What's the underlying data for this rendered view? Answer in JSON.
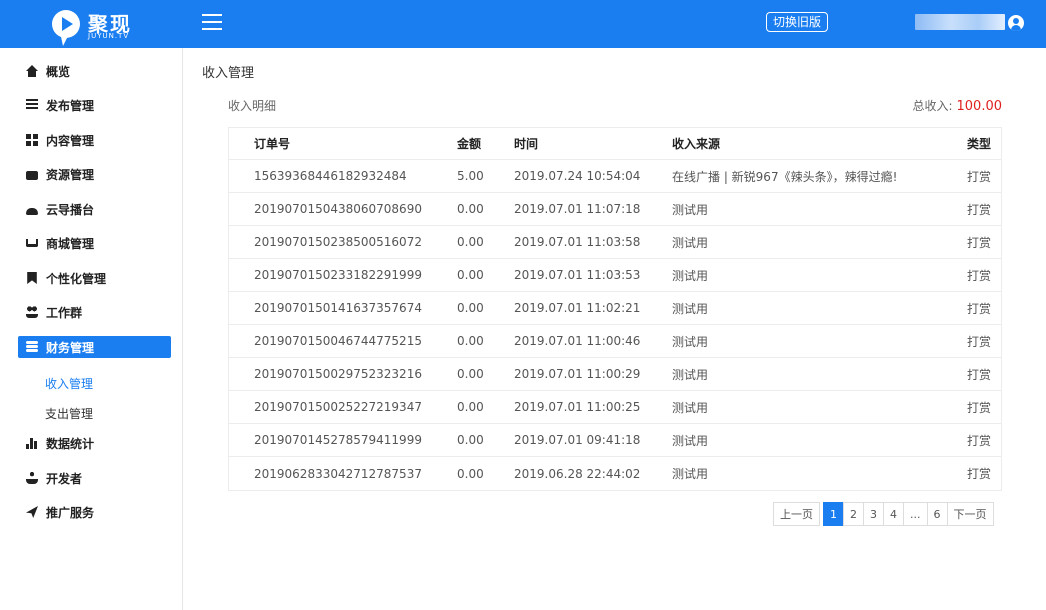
{
  "header": {
    "brand": "聚现",
    "brand_sub": "JUYUN.TV",
    "old_version_label": "切换旧版",
    "colors": {
      "primary": "#1a7ef0"
    }
  },
  "sidebar": {
    "items": [
      {
        "label": "概览",
        "icon": "home-icon"
      },
      {
        "label": "发布管理",
        "icon": "list-icon"
      },
      {
        "label": "内容管理",
        "icon": "grid-icon"
      },
      {
        "label": "资源管理",
        "icon": "hdd-icon"
      },
      {
        "label": "云导播台",
        "icon": "cloud-icon"
      },
      {
        "label": "商城管理",
        "icon": "cart-icon"
      },
      {
        "label": "个性化管理",
        "icon": "bookmark-icon"
      },
      {
        "label": "工作群",
        "icon": "users-icon"
      },
      {
        "label": "财务管理",
        "icon": "database-icon"
      },
      {
        "label": "数据统计",
        "icon": "bar-chart-icon"
      },
      {
        "label": "开发者",
        "icon": "user-icon"
      },
      {
        "label": "推广服务",
        "icon": "send-icon"
      }
    ],
    "sub_items": [
      {
        "label": "收入管理"
      },
      {
        "label": "支出管理"
      }
    ]
  },
  "main": {
    "page_title": "收入管理",
    "section_title": "收入明细",
    "total_label": "总收入:",
    "total_amount": "100.00",
    "table": {
      "headers": [
        "订单号",
        "金额",
        "时间",
        "收入来源",
        "类型"
      ],
      "rows": [
        [
          "15639368446182932484",
          "5.00",
          "2019.07.24 10:54:04",
          "在线广播 | 新锐967《辣头条》，辣得过瘾!",
          "打赏"
        ],
        [
          "201907015043806070869​0",
          "0.00",
          "2019.07.01 11:07:18",
          "测试用",
          "打赏"
        ],
        [
          "20190701502385005​16072",
          "0.00",
          "2019.07.01 11:03:58",
          "测试用",
          "打赏"
        ],
        [
          "20190701502331822​91999",
          "0.00",
          "2019.07.01 11:03:53",
          "测试用",
          "打赏"
        ],
        [
          "20190701501416373​57674",
          "0.00",
          "2019.07.01 11:02:21",
          "测试用",
          "打赏"
        ],
        [
          "20190701500467447​75215",
          "0.00",
          "2019.07.01 11:00:46",
          "测试用",
          "打赏"
        ],
        [
          "20190701500297523​23216",
          "0.00",
          "2019.07.01 11:00:29",
          "测试用",
          "打赏"
        ],
        [
          "20190701500252272​19347",
          "0.00",
          "2019.07.01 11:00:25",
          "测试用",
          "打赏"
        ],
        [
          "20190701452785794​11999",
          "0.00",
          "2019.07.01 09:41:18",
          "测试用",
          "打赏"
        ],
        [
          "20190628330427127​87537",
          "0.00",
          "2019.06.28 22:44:02",
          "测试用",
          "打赏"
        ]
      ]
    },
    "pagination": {
      "prev": "上一页",
      "pages": [
        "1",
        "2",
        "3",
        "4",
        "...",
        "6"
      ],
      "next": "下一页",
      "current": "1"
    }
  }
}
